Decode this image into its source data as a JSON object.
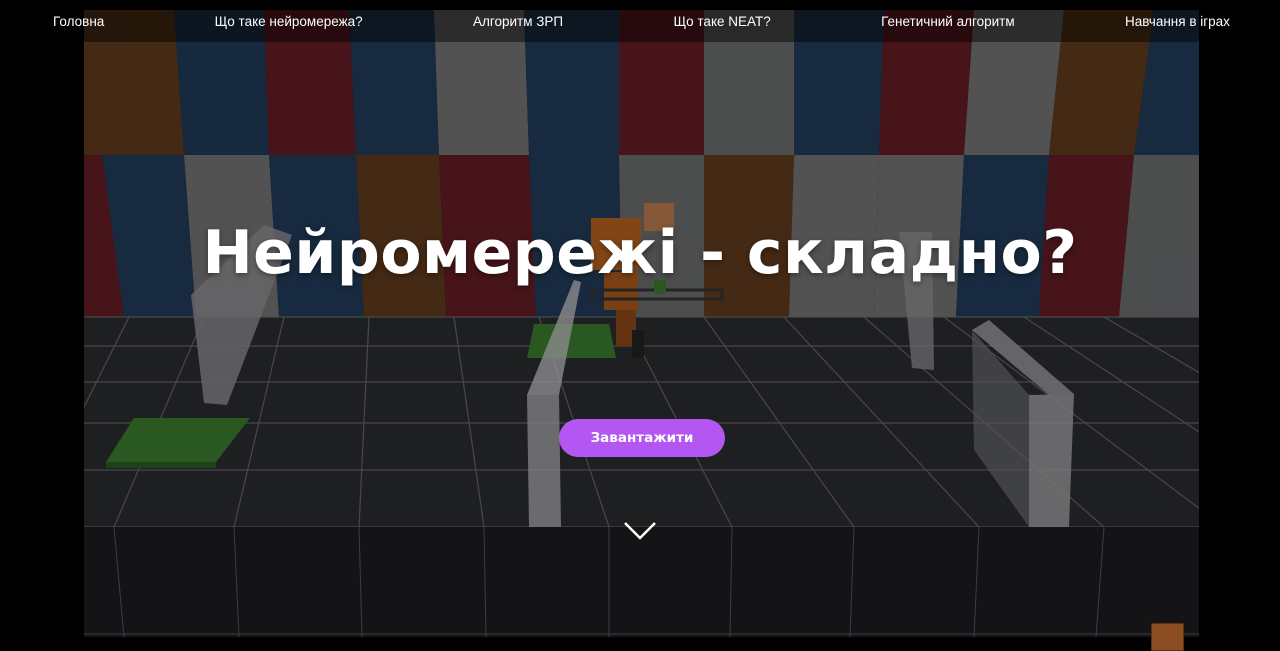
{
  "nav": {
    "items": [
      {
        "label": "Головна"
      },
      {
        "label": "Що таке нейромережа?"
      },
      {
        "label": "Алгоритм ЗРП"
      },
      {
        "label": "Що таке NEAT?"
      },
      {
        "label": "Генетичний алгоритм"
      },
      {
        "label": "Навчання в іграх"
      }
    ]
  },
  "hero": {
    "headline": "Нейромережі - складно?",
    "cta_label": "Завантажити",
    "scroll_icon": "chevron-down-icon",
    "background": "game-scene-robot-obstacle-course",
    "corner_icon": "robot-avatar-icon"
  },
  "colors": {
    "accent": "#b457f2",
    "nav_text": "#ffffff",
    "page_background": "#000000"
  }
}
